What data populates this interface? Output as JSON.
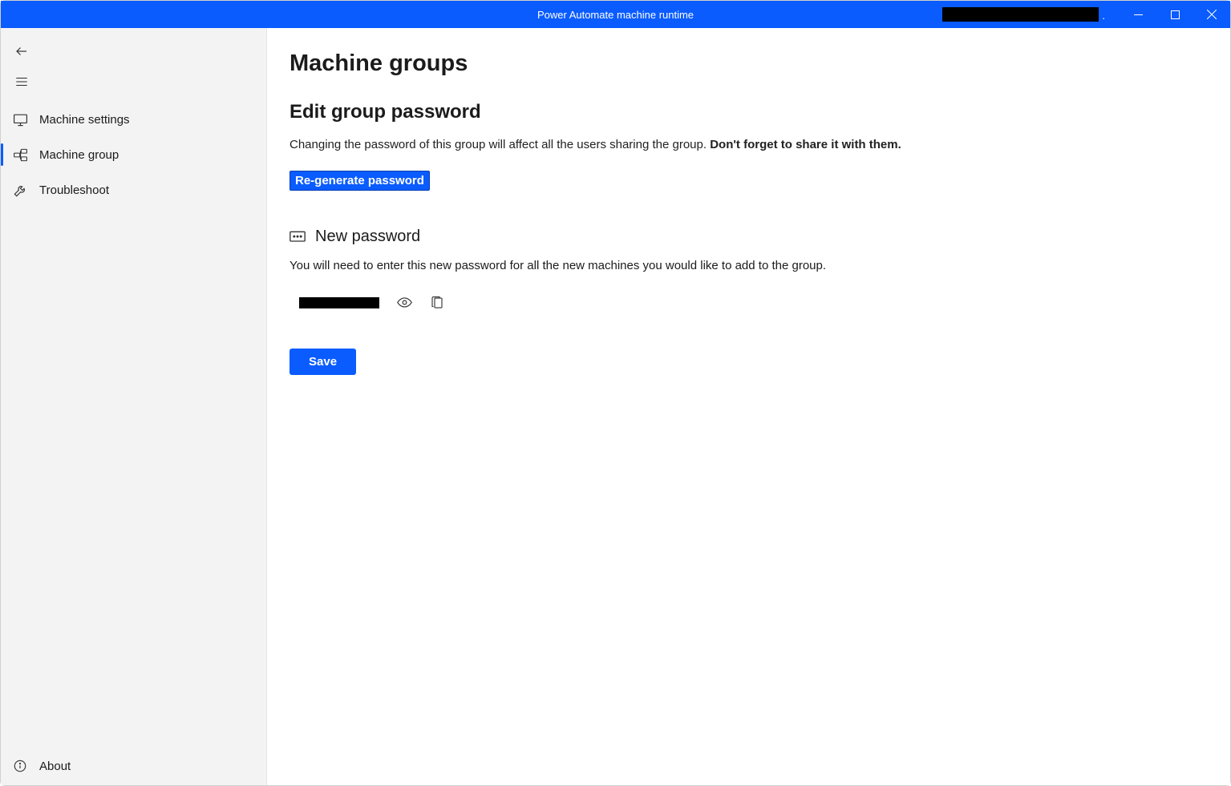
{
  "titlebar": {
    "title": "Power Automate machine runtime"
  },
  "sidebar": {
    "items": [
      {
        "label": "Machine settings"
      },
      {
        "label": "Machine group"
      },
      {
        "label": "Troubleshoot"
      }
    ],
    "footer": {
      "label": "About"
    }
  },
  "main": {
    "page_title": "Machine groups",
    "section_title": "Edit group password",
    "desc_lead": "Changing the password of this group will affect all the users sharing the group. ",
    "desc_bold": "Don't forget to share it with them.",
    "regen_label": "Re-generate password",
    "new_pw_title": "New password",
    "new_pw_desc": "You will need to enter this new password for all the new machines you would like to add to the group.",
    "save_label": "Save"
  }
}
